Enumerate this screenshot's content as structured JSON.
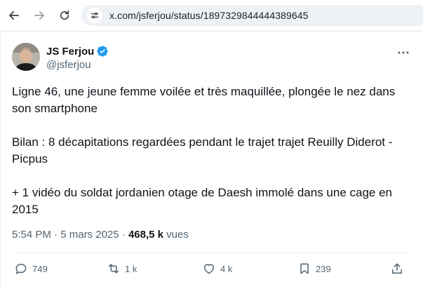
{
  "browser": {
    "url": "x.com/jsferjou/status/1897329844444389645"
  },
  "tweet": {
    "author_name": "JS Ferjou",
    "author_handle": "@jsferjou",
    "paragraphs": [
      "Ligne 46, une jeune femme voilée et très maquillée, plongée le nez dans son smartphone",
      "Bilan : 8 décapitations regardées pendant le trajet trajet Reuilly Diderot - Picpus",
      "+ 1 vidéo du soldat jordanien otage de Daesh immolé dans une cage en 2015"
    ],
    "time": "5:54 PM",
    "date": "5 mars 2025",
    "separator": "·",
    "views_count": "468,5 k",
    "views_label": "vues",
    "actions": {
      "replies": "749",
      "reposts": "1 k",
      "likes": "4 k",
      "bookmarks": "239"
    }
  },
  "colors": {
    "verified_blue": "#1d9bf0",
    "secondary_text": "#536471",
    "primary_text": "#0f1419"
  },
  "icons": [
    "back-arrow-icon",
    "forward-arrow-icon",
    "reload-icon",
    "site-settings-icon",
    "verified-badge-icon",
    "more-icon",
    "reply-icon",
    "repost-icon",
    "like-icon",
    "bookmark-icon",
    "share-icon"
  ]
}
